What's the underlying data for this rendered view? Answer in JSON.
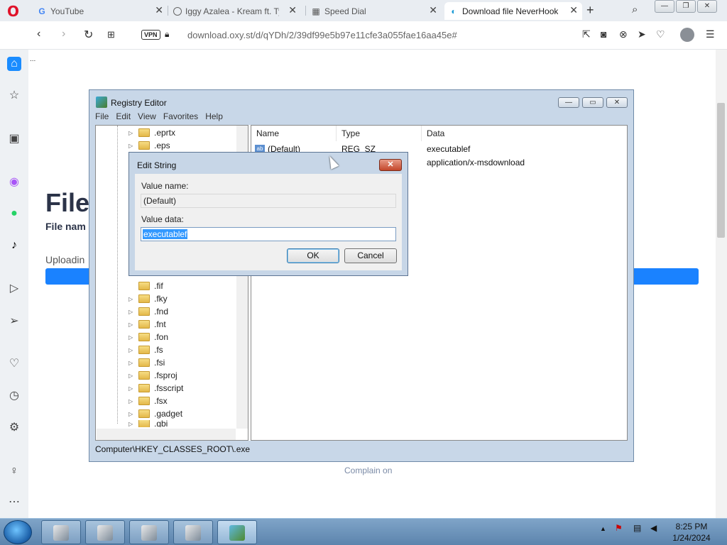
{
  "browser": {
    "tabs": [
      {
        "label": "YouTube",
        "icon": "G"
      },
      {
        "label": "Iggy Azalea - Kream ft. Ty",
        "icon": " "
      },
      {
        "label": "Speed Dial",
        "icon": "▦"
      },
      {
        "label": "Download file NeverHook",
        "icon": "◐"
      }
    ],
    "vpn_label": "VPN",
    "url": "download.oxy.st/d/qYDh/2/39df99e5b97e11cfe3a055fae16aa45e#"
  },
  "page": {
    "dots": "...",
    "title": "File",
    "subtitle": "File nam",
    "uploading": "Uploadin",
    "progress": 1.0,
    "complain": "Complain on"
  },
  "regedit": {
    "title": "Registry Editor",
    "menu": [
      "File",
      "Edit",
      "View",
      "Favorites",
      "Help"
    ],
    "tree": [
      ".eprtx",
      ".eps",
      ".fif",
      ".fky",
      ".fnd",
      ".fnt",
      ".fon",
      ".fs",
      ".fsi",
      ".fsproj",
      ".fsscript",
      ".fsx",
      ".gadget",
      ".gbi"
    ],
    "columns": [
      "Name",
      "Type",
      "Data"
    ],
    "rows": [
      {
        "name": "(Default)",
        "type": "REG_SZ",
        "data": "executablef"
      },
      {
        "name": "",
        "type": "",
        "data": "application/x-msdownload"
      }
    ],
    "status": "Computer\\HKEY_CLASSES_ROOT\\.exe"
  },
  "dialog": {
    "title": "Edit String",
    "value_name_label": "Value name:",
    "value_name": "(Default)",
    "value_data_label": "Value data:",
    "value_data": "executablef",
    "ok": "OK",
    "cancel": "Cancel"
  },
  "taskbar": {
    "time": "8:25 PM",
    "date": "1/24/2024"
  }
}
